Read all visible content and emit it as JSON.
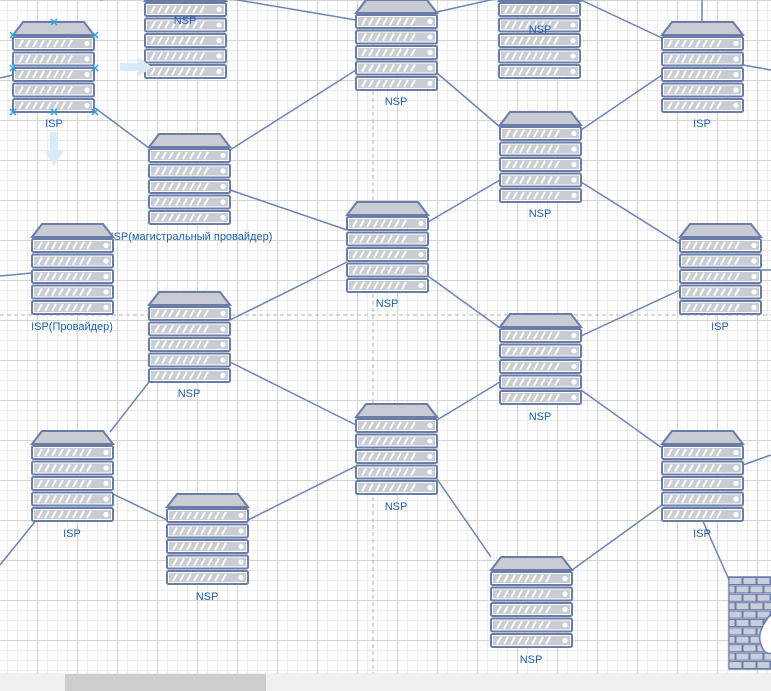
{
  "colors": {
    "link": "#6c84b3",
    "server_outline": "#6a7ca8",
    "server_fill": "#c9ccd3",
    "label": "#1f5fa8",
    "selection": "#29a8e0",
    "guide": "#b0b0b0",
    "arrow": "#d9ebf8"
  },
  "nodes": [
    {
      "id": "isp-top-left",
      "label": "ISP"
    },
    {
      "id": "nsp-top-a",
      "label": "NSP"
    },
    {
      "id": "nsp-top-center",
      "label": "NSP"
    },
    {
      "id": "nsp-top-b",
      "label": "NSP"
    },
    {
      "id": "isp-top-right",
      "label": "ISP"
    },
    {
      "id": "nsp-backbone",
      "label": "NSP(магистральный провайдер)"
    },
    {
      "id": "nsp-right-upper",
      "label": "NSP"
    },
    {
      "id": "isp-provider",
      "label": "ISP(Провайдер)"
    },
    {
      "id": "nsp-center",
      "label": "NSP"
    },
    {
      "id": "isp-right-mid",
      "label": "ISP"
    },
    {
      "id": "nsp-left-mid",
      "label": "NSP"
    },
    {
      "id": "nsp-right-mid",
      "label": "NSP"
    },
    {
      "id": "isp-left-low",
      "label": "ISP"
    },
    {
      "id": "nsp-center-low",
      "label": "NSP"
    },
    {
      "id": "isp-right-low",
      "label": "ISP"
    },
    {
      "id": "nsp-low-left",
      "label": "NSP"
    },
    {
      "id": "nsp-bottom",
      "label": "NSP"
    }
  ],
  "firewall": {
    "icon": "firewall-icon"
  },
  "scrollbar": {
    "icon": "horizontal-scrollbar"
  }
}
